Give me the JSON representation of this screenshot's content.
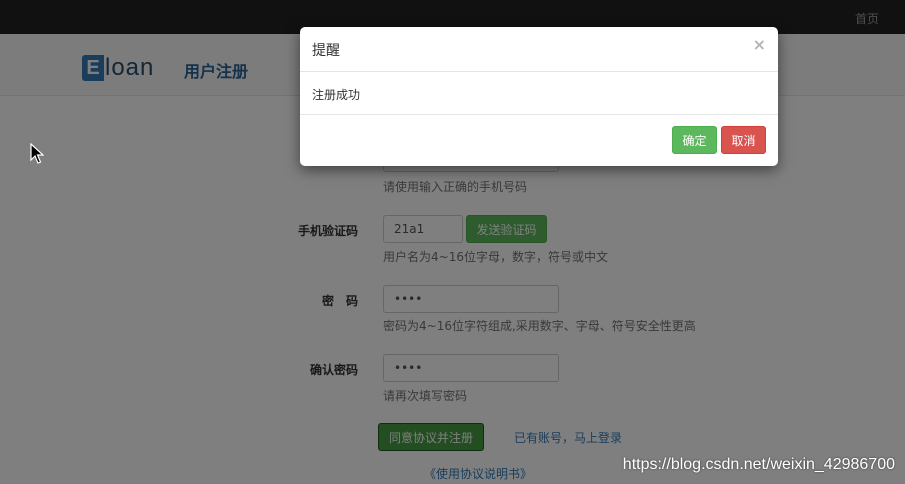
{
  "topbar": {
    "home_label": "首页"
  },
  "header": {
    "logo_letter": "E",
    "logo_rest": "loan",
    "page_title": "用户注册"
  },
  "form": {
    "phone_hint": "请使用输入正确的手机号码",
    "verify": {
      "label": "手机验证码",
      "value": "21a1",
      "send_button": "发送验证码",
      "hint": "用户名为4~16位字母，数字，符号或中文"
    },
    "password": {
      "label": "密　码",
      "value": "••••",
      "hint": "密码为4~16位字符组成,采用数字、字母、符号安全性更高"
    },
    "confirm": {
      "label": "确认密码",
      "value": "••••",
      "hint": "请再次填写密码"
    },
    "submit_button": "同意协议并注册",
    "login_link": "已有账号，马上登录",
    "agreement_link": "《使用协议说明书》"
  },
  "modal": {
    "title": "提醒",
    "close_glyph": "×",
    "message": "注册成功",
    "ok_button": "确定",
    "cancel_button": "取消"
  },
  "watermark": "https://blog.csdn.net/weixin_42986700",
  "colors": {
    "topbar": "#222222",
    "primary_link": "#337ab7",
    "success": "#5cb85c",
    "danger": "#d9534f"
  }
}
